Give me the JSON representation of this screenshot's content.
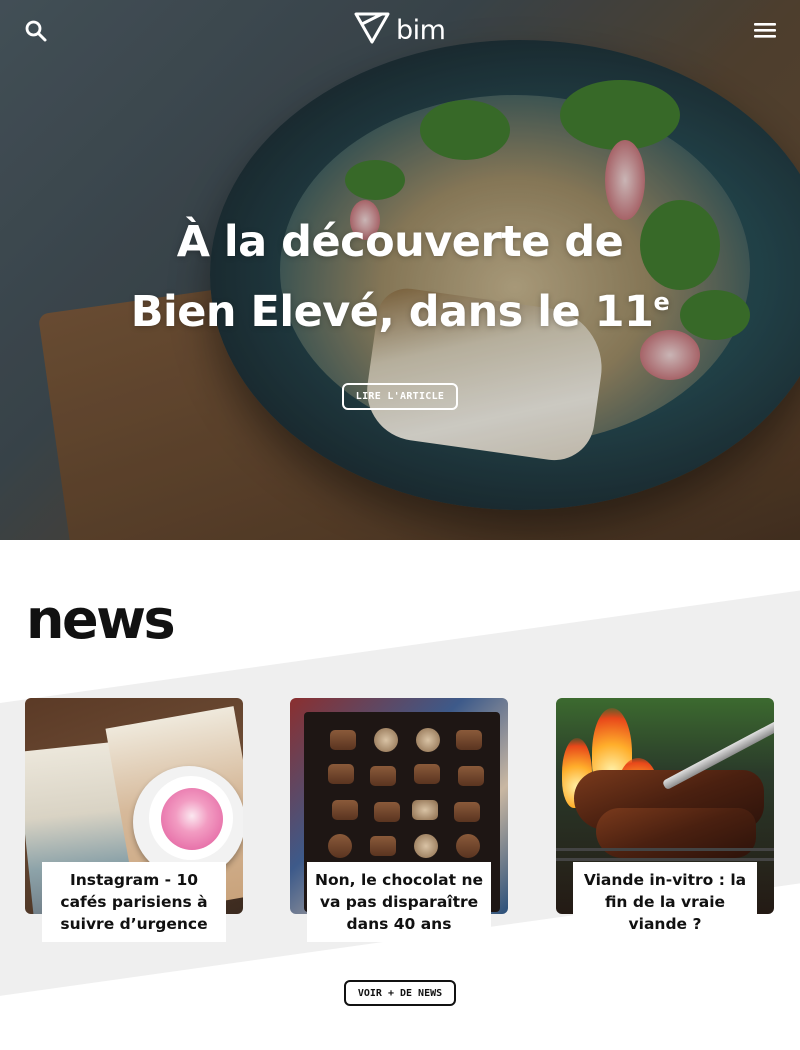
{
  "header": {
    "logo_text": "bim",
    "icons": {
      "search": "search-icon",
      "menu": "hamburger-menu-icon",
      "logo": "triangle-logo-icon"
    }
  },
  "hero": {
    "title_line1": "À la découverte de",
    "title_line2": "Bien Elevé, dans le 11",
    "title_sup": "e",
    "cta_label": "LIRE L'ARTICLE"
  },
  "news": {
    "heading": "news",
    "cards": [
      {
        "title": "Instagram - 10 cafés parisiens à suivre d’urgence"
      },
      {
        "title": "Non, le chocolat ne va pas disparaître dans 40 ans"
      },
      {
        "title": "Viande in-vitro : la fin de la vraie viande ?"
      }
    ],
    "more_label": "VOIR + DE NEWS"
  },
  "colors": {
    "text": "#111111",
    "band": "#efefef",
    "hero_text": "#ffffff"
  }
}
